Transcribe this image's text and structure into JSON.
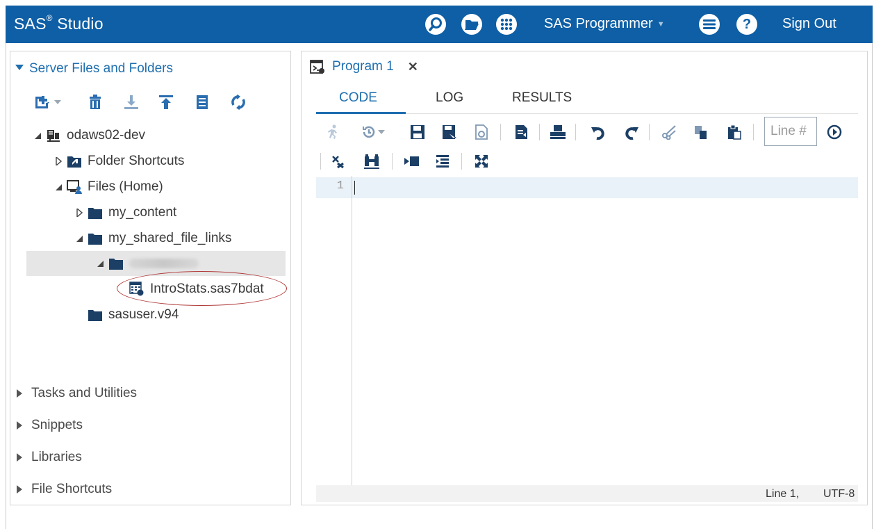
{
  "header": {
    "brand": "SAS",
    "brand_sup": "®",
    "brand_suffix": "Studio",
    "perspective": "SAS Programmer",
    "sign_out": "Sign Out",
    "icons": [
      "search-icon",
      "open-folder-icon",
      "apps-grid-icon",
      "menu-icon",
      "help-icon"
    ],
    "accent_color": "#0e5fa5"
  },
  "navigator": {
    "section_title": "Server Files and Folders",
    "toolbar_icons": [
      "new-item-icon",
      "delete-icon",
      "download-icon",
      "upload-icon",
      "properties-icon",
      "refresh-icon"
    ],
    "tree": [
      {
        "label": "odaws02-dev",
        "icon": "server-icon",
        "expanded": true,
        "level": 0
      },
      {
        "label": "Folder Shortcuts",
        "icon": "folder-shortcut-icon",
        "expanded": false,
        "level": 1
      },
      {
        "label": "Files (Home)",
        "icon": "home-icon",
        "expanded": true,
        "level": 1
      },
      {
        "label": "my_content",
        "icon": "folder-icon",
        "expanded": false,
        "level": 2
      },
      {
        "label": "my_shared_file_links",
        "icon": "folder-icon",
        "expanded": true,
        "level": 2
      },
      {
        "label": "",
        "icon": "folder-icon",
        "expanded": true,
        "level": 3,
        "selected": true
      },
      {
        "label": "IntroStats.sas7bdat",
        "icon": "dataset-icon",
        "level": 4,
        "highlighted": true
      },
      {
        "label": "sasuser.v94",
        "icon": "folder-icon",
        "level": 2
      }
    ],
    "collapsed_sections": [
      "Tasks and Utilities",
      "Snippets",
      "Libraries",
      "File Shortcuts"
    ]
  },
  "editor": {
    "tab_title": "Program 1",
    "close_glyph": "✕",
    "subtabs": [
      "CODE",
      "LOG",
      "RESULTS"
    ],
    "active_subtab": "CODE",
    "line_placeholder": "Line #",
    "line_numbers": [
      "1"
    ],
    "status_line": "Line 1,",
    "status_encoding": "UTF-8"
  }
}
